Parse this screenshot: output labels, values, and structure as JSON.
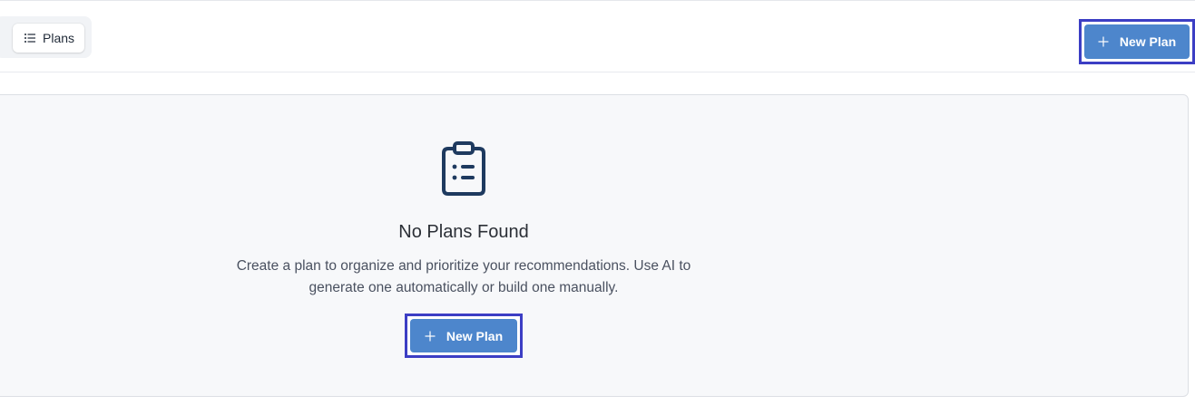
{
  "header": {
    "tabs": [
      {
        "label": "Plans",
        "icon": "list-icon",
        "active": true
      }
    ],
    "new_plan_button": {
      "label": "New Plan",
      "icon": "plus-icon"
    }
  },
  "empty_state": {
    "icon": "clipboard-list-icon",
    "title": "No Plans Found",
    "description": "Create a plan to organize and prioritize your recommendations. Use AI to generate one automatically or build one manually.",
    "new_plan_button": {
      "label": "New Plan",
      "icon": "plus-icon"
    }
  },
  "colors": {
    "primary": "#4d86cc",
    "highlight": "#3c3ec4",
    "icon_dark": "#1e3a5f",
    "card_bg": "#f7f8fa"
  }
}
